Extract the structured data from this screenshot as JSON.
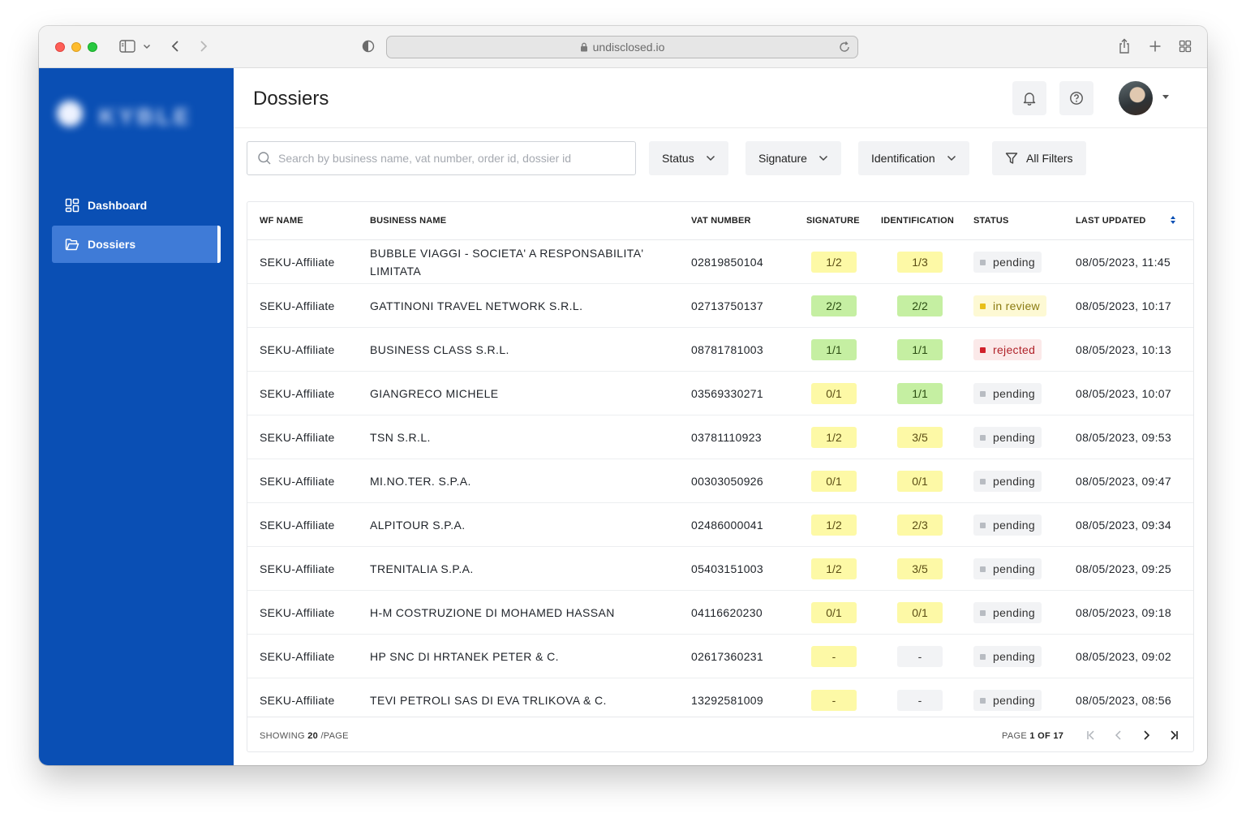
{
  "browser": {
    "url": "undisclosed.io"
  },
  "sidebar": {
    "logo_text": "KYBLE",
    "items": [
      {
        "label": "Dashboard",
        "icon": "dashboard-icon"
      },
      {
        "label": "Dossiers",
        "icon": "folder-icon",
        "active": true
      }
    ]
  },
  "header": {
    "title": "Dossiers"
  },
  "search": {
    "placeholder": "Search by business name, vat number, order id, dossier id",
    "value": ""
  },
  "filters": {
    "status": "Status",
    "signature": "Signature",
    "identification": "Identification",
    "all": "All Filters"
  },
  "table": {
    "columns": [
      "WF NAME",
      "BUSINESS NAME",
      "VAT NUMBER",
      "SIGNATURE",
      "IDENTIFICATION",
      "STATUS",
      "LAST UPDATED"
    ],
    "rows": [
      {
        "wf": "SEKU-Affiliate",
        "business": "BUBBLE VIAGGI - SOCIETA' A RESPONSABILITA' LIMITATA",
        "vat": "02819850104",
        "signature": "1/2",
        "sig_color": "yellow",
        "identification": "1/3",
        "id_color": "yellow",
        "status": "pending",
        "status_kind": "pending",
        "updated": "08/05/2023, 11:45"
      },
      {
        "wf": "SEKU-Affiliate",
        "business": "GATTINONI TRAVEL NETWORK S.R.L.",
        "vat": "02713750137",
        "signature": "2/2",
        "sig_color": "green",
        "identification": "2/2",
        "id_color": "green",
        "status": "in review",
        "status_kind": "review",
        "updated": "08/05/2023, 10:17"
      },
      {
        "wf": "SEKU-Affiliate",
        "business": "BUSINESS CLASS S.R.L.",
        "vat": "08781781003",
        "signature": "1/1",
        "sig_color": "green",
        "identification": "1/1",
        "id_color": "green",
        "status": "rejected",
        "status_kind": "rejected",
        "updated": "08/05/2023, 10:13"
      },
      {
        "wf": "SEKU-Affiliate",
        "business": "GIANGRECO MICHELE",
        "vat": "03569330271",
        "signature": "0/1",
        "sig_color": "yellow",
        "identification": "1/1",
        "id_color": "green",
        "status": "pending",
        "status_kind": "pending",
        "updated": "08/05/2023, 10:07"
      },
      {
        "wf": "SEKU-Affiliate",
        "business": "TSN S.R.L.",
        "vat": "03781110923",
        "signature": "1/2",
        "sig_color": "yellow",
        "identification": "3/5",
        "id_color": "yellow",
        "status": "pending",
        "status_kind": "pending",
        "updated": "08/05/2023, 09:53"
      },
      {
        "wf": "SEKU-Affiliate",
        "business": "MI.NO.TER. S.P.A.",
        "vat": "00303050926",
        "signature": "0/1",
        "sig_color": "yellow",
        "identification": "0/1",
        "id_color": "yellow",
        "status": "pending",
        "status_kind": "pending",
        "updated": "08/05/2023, 09:47"
      },
      {
        "wf": "SEKU-Affiliate",
        "business": "ALPITOUR S.P.A.",
        "vat": "02486000041",
        "signature": "1/2",
        "sig_color": "yellow",
        "identification": "2/3",
        "id_color": "yellow",
        "status": "pending",
        "status_kind": "pending",
        "updated": "08/05/2023, 09:34"
      },
      {
        "wf": "SEKU-Affiliate",
        "business": "TRENITALIA S.P.A.",
        "vat": "05403151003",
        "signature": "1/2",
        "sig_color": "yellow",
        "identification": "3/5",
        "id_color": "yellow",
        "status": "pending",
        "status_kind": "pending",
        "updated": "08/05/2023, 09:25"
      },
      {
        "wf": "SEKU-Affiliate",
        "business": "H-M COSTRUZIONE DI MOHAMED HASSAN",
        "vat": "04116620230",
        "signature": "0/1",
        "sig_color": "yellow",
        "identification": "0/1",
        "id_color": "yellow",
        "status": "pending",
        "status_kind": "pending",
        "updated": "08/05/2023, 09:18"
      },
      {
        "wf": "SEKU-Affiliate",
        "business": "HP SNC DI HRTANEK PETER & C.",
        "vat": "02617360231",
        "signature": "-",
        "sig_color": "yellow",
        "identification": "-",
        "id_color": "gray",
        "status": "pending",
        "status_kind": "pending",
        "updated": "08/05/2023, 09:02"
      },
      {
        "wf": "SEKU-Affiliate",
        "business": "TEVI PETROLI SAS DI EVA TRLIKOVA & C.",
        "vat": "13292581009",
        "signature": "-",
        "sig_color": "yellow",
        "identification": "-",
        "id_color": "gray",
        "status": "pending",
        "status_kind": "pending",
        "updated": "08/05/2023, 08:56"
      }
    ]
  },
  "footer": {
    "showing_label": "SHOWING",
    "per_page": "20",
    "per_page_suffix": "/PAGE",
    "page_label": "PAGE",
    "current_page": "1",
    "of_label": "OF",
    "total_pages": "17"
  },
  "colors": {
    "sidebar": "#0a4fb4",
    "sidebar_active": "#3f7bd7",
    "pill_yellow": "#fdf9a6",
    "pill_green": "#c5efa2",
    "status_rejected": "#d0212b",
    "status_review": "#e8bf19"
  }
}
